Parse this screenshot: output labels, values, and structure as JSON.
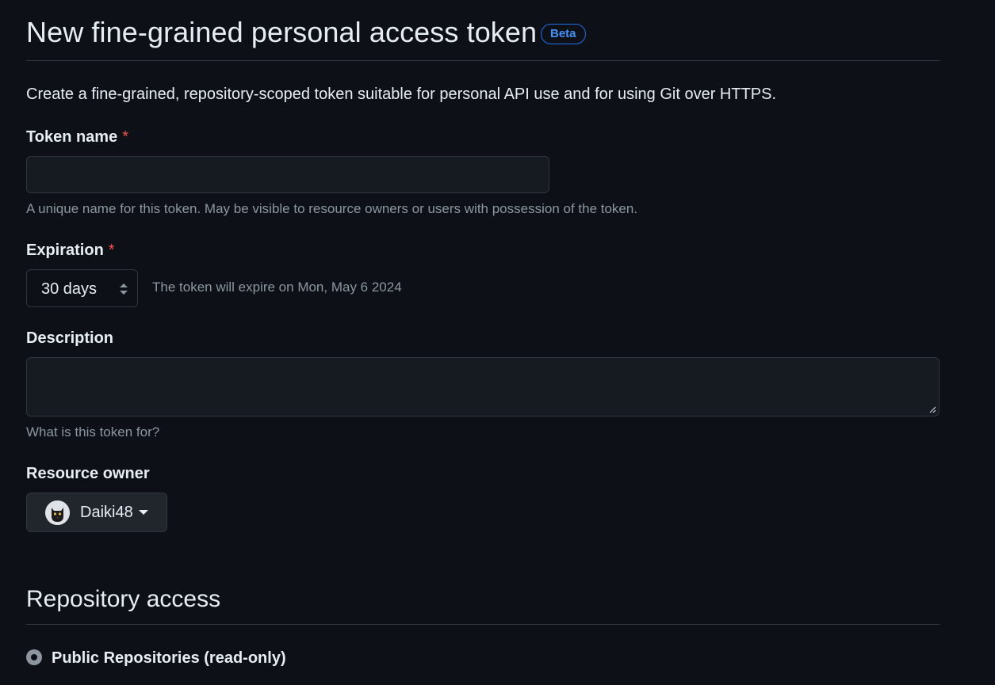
{
  "header": {
    "title": "New fine-grained personal access token",
    "badge": "Beta"
  },
  "intro": "Create a fine-grained, repository-scoped token suitable for personal API use and for using Git over HTTPS.",
  "token_name": {
    "label": "Token name",
    "required_mark": "*",
    "value": "",
    "note": "A unique name for this token. May be visible to resource owners or users with possession of the token."
  },
  "expiration": {
    "label": "Expiration",
    "required_mark": "*",
    "selected": "30 days",
    "note": "The token will expire on Mon, May 6 2024"
  },
  "description": {
    "label": "Description",
    "value": "",
    "note": "What is this token for?"
  },
  "resource_owner": {
    "label": "Resource owner",
    "selected": "Daiki48",
    "icon": "chevron-down-icon"
  },
  "repository_access": {
    "title": "Repository access",
    "options": [
      {
        "label": "Public Repositories (read-only)",
        "selected": true
      }
    ]
  },
  "colors": {
    "background": "#0d1117",
    "accent": "#4493f8",
    "required": "#f85149",
    "muted_text": "#8d96a0",
    "border": "#30363d"
  }
}
